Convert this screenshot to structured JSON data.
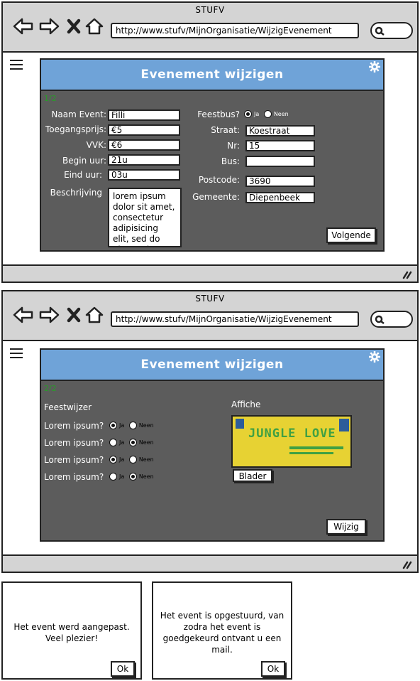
{
  "window1": {
    "title": "STUFV",
    "url": "http://www.stufv/MijnOrganisatie/WijzigEvenement",
    "panel_title": "Evenement wijzigen",
    "step": "1/2",
    "labels": {
      "naam": "Naam Event:",
      "toegang": "Toegangsprijs:",
      "vvk": "VVK:",
      "begin": "Begin uur:",
      "eind": "Eind uur:",
      "beschrijving": "Beschrijving",
      "feestbus": "Feestbus?",
      "straat": "Straat:",
      "nr": "Nr:",
      "bus": "Bus:",
      "postcode": "Postcode:",
      "gemeente": "Gemeente:"
    },
    "values": {
      "naam": "Filli",
      "toegang": "€5",
      "vvk": "€6",
      "begin": "21u",
      "eind": "03u",
      "beschrijving": "lorem ipsum dolor sit amet, consectetur adipisicing elit, sed do eiusmod",
      "straat": "Koestraat",
      "nr": "15",
      "bus": "",
      "postcode": "3690",
      "gemeente": "Diepenbeek"
    },
    "feestbus_options": {
      "ja": "Ja",
      "neen": "Neen",
      "selected": "Ja"
    },
    "next_button": "Volgende"
  },
  "window2": {
    "title": "STUFV",
    "url": "http://www.stufv/MijnOrganisatie/WijzigEvenement",
    "panel_title": "Evenement wijzigen",
    "step": "2/2",
    "feestwijzer_label": "Feestwijzer",
    "questions": [
      {
        "label": "Lorem ipsum?",
        "ja": "Ja",
        "neen": "Neen",
        "selected": "Ja"
      },
      {
        "label": "Lorem ipsum?",
        "ja": "Ja",
        "neen": "Neen",
        "selected": "Neen"
      },
      {
        "label": "Lorem ipsum?",
        "ja": "Ja",
        "neen": "Neen",
        "selected": "Ja"
      },
      {
        "label": "Lorem ipsum?",
        "ja": "Ja",
        "neen": "Neen",
        "selected": "Neen"
      }
    ],
    "affiche_label": "Affiche",
    "affiche_title": "JUNGLE LOVE",
    "browse_button": "Blader",
    "submit_button": "Wijzig"
  },
  "dialog1": {
    "message": "Het event werd aangepast. Veel plezier!",
    "ok": "Ok"
  },
  "dialog2": {
    "message": "Het event is opgestuurd, van zodra het event is goedgekeurd ontvant u een mail.",
    "ok": "Ok"
  },
  "icons": [
    "back-icon",
    "forward-icon",
    "close-icon",
    "home-icon",
    "search-icon",
    "menu-icon",
    "gear-icon",
    "resize-icon"
  ],
  "colors": {
    "header_blue": "#6fa3d8",
    "panel_gray": "#5c5c5c",
    "chrome_gray": "#d4d4d4",
    "step_green": "#2a9a2a"
  }
}
